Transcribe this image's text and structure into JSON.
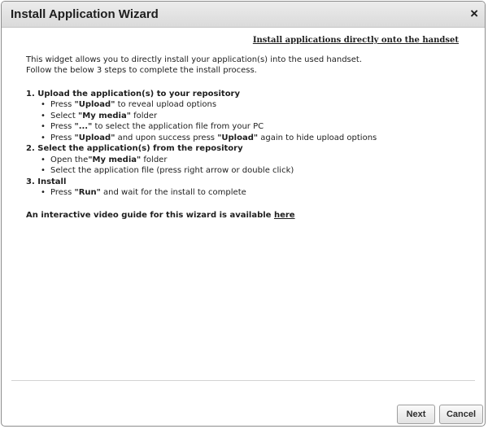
{
  "dialog": {
    "title": "Install Application Wizard",
    "close_glyph": "×"
  },
  "content": {
    "heading": "Install applications directly onto the handset",
    "intro_line1": "This widget allows you to directly install your application(s) into the used handset.",
    "intro_line2": "Follow the below 3 steps to complete the install process.",
    "step1": {
      "title": "1. Upload the application(s) to your repository",
      "items": [
        {
          "pre": "Press ",
          "bold": "\"Upload\"",
          "post": " to reveal upload options"
        },
        {
          "pre": "Select ",
          "bold": "\"My media\"",
          "post": " folder"
        },
        {
          "pre": "Press ",
          "bold": "\"...\"",
          "post": " to select the application file from your PC"
        },
        {
          "pre": "Press ",
          "bold": "\"Upload\"",
          "post": " and upon success press ",
          "bold2": "\"Upload\"",
          "post2": " again to hide upload options"
        }
      ]
    },
    "step2": {
      "title": "2. Select the application(s) from the repository",
      "items": [
        {
          "pre": "Open the",
          "bold": "\"My media\"",
          "post": " folder"
        },
        {
          "pre": "Select the application file (press right arrow or double click)"
        }
      ]
    },
    "step3": {
      "title": "3. Install",
      "items": [
        {
          "pre": "Press ",
          "bold": "\"Run\"",
          "post": " and wait for the install to complete"
        }
      ]
    },
    "video_text": "An interactive video guide for this wizard is available ",
    "video_link": "here"
  },
  "footer": {
    "next_label": "Next",
    "cancel_label": "Cancel"
  }
}
